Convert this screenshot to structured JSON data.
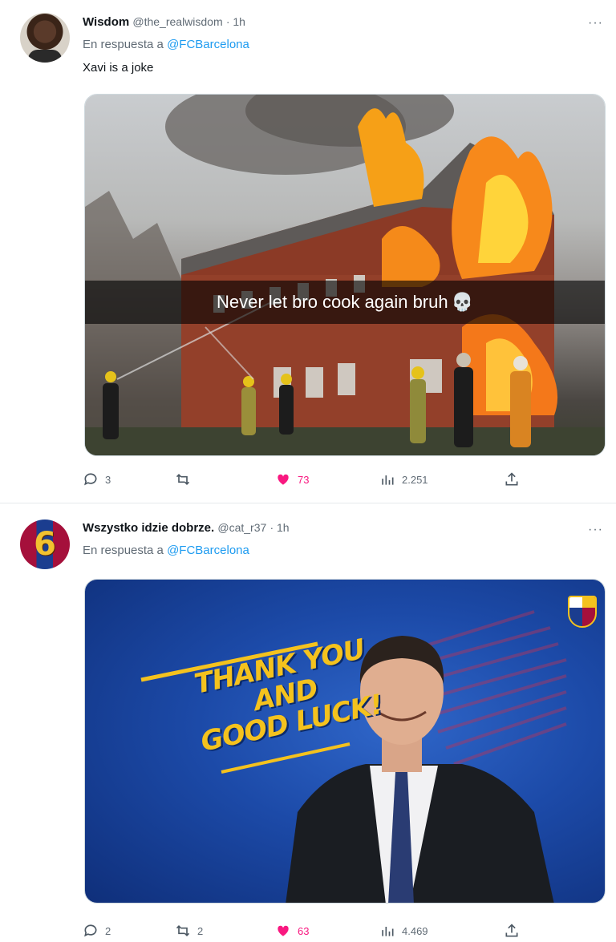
{
  "tweets": [
    {
      "author_name": "Wisdom",
      "author_handle": "@the_realwisdom",
      "time": "· 1h",
      "more_icon": "more-horizontal-icon",
      "reply_prefix": "En respuesta a ",
      "reply_to": "@FCBarcelona",
      "text": "Xavi is a joke",
      "media_caption": "Never let bro cook again bruh",
      "caption_emoji": "💀",
      "stats": {
        "replies": "3",
        "retweets": "",
        "likes": "73",
        "views": "2.251"
      }
    },
    {
      "author_name": "Wszystko idzie dobrze.",
      "author_handle": "@cat_r37",
      "time": "· 1h",
      "more_icon": "more-horizontal-icon",
      "avatar_text": "6",
      "reply_prefix": "En respuesta a ",
      "reply_to": "@FCBarcelona",
      "media_text": [
        "THANK YOU",
        "AND",
        "GOOD LUCK!"
      ],
      "stats": {
        "replies": "2",
        "retweets": "2",
        "likes": "63",
        "views": "4.469"
      }
    }
  ],
  "colors": {
    "accent_link": "#1d9bf0",
    "like_pink": "#f91880",
    "secondary_text": "#606b75"
  }
}
